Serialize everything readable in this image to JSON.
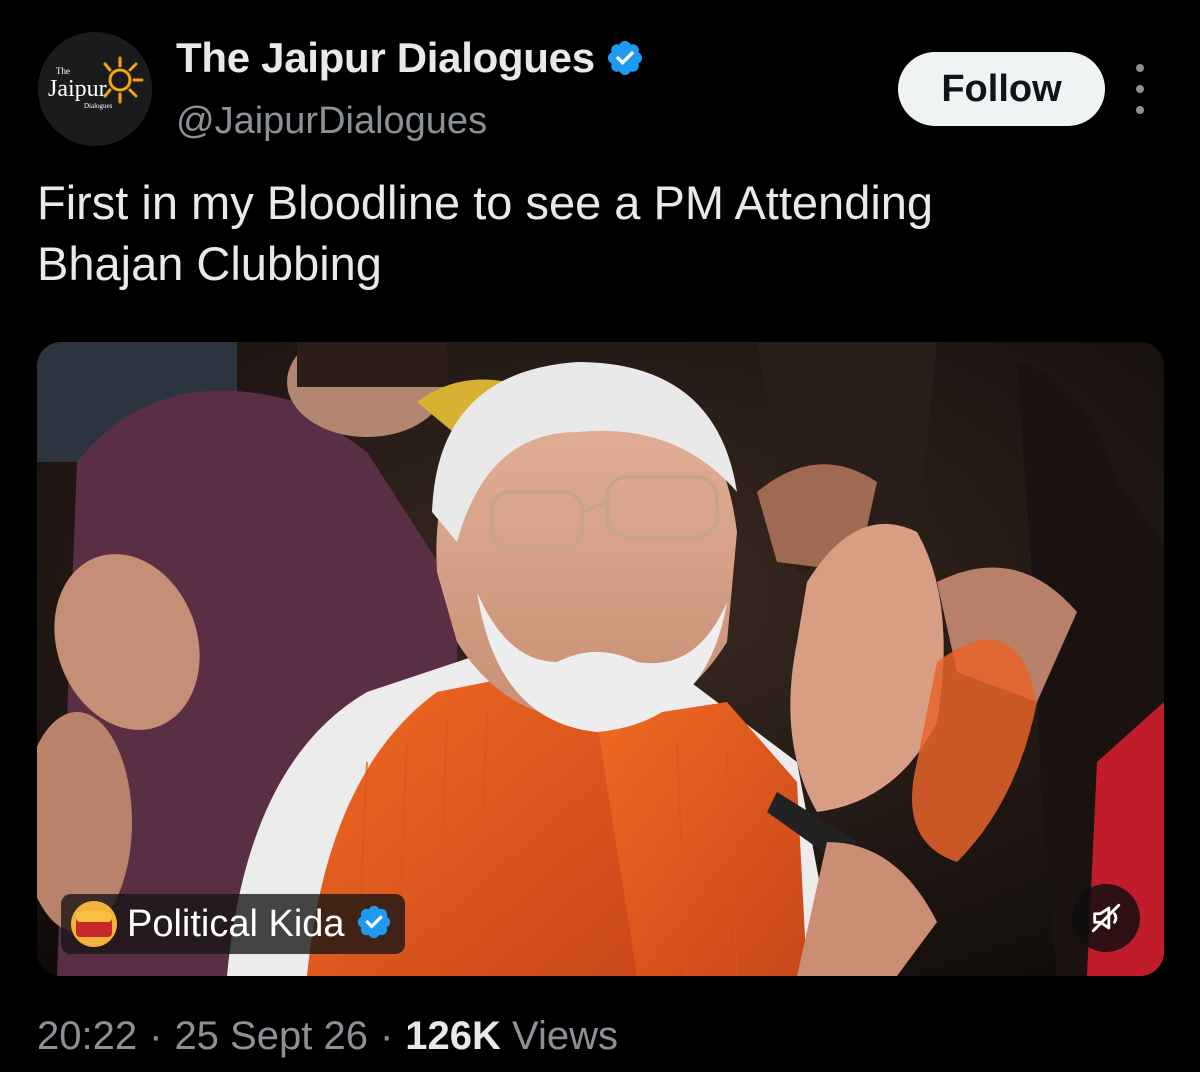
{
  "author": {
    "display_name": "The Jaipur Dialogues",
    "handle": "@JaipurDialogues",
    "verified": true,
    "avatar": {
      "top_text": "The",
      "main_text": "Jaipur",
      "sub_text": "Dialogues",
      "accent_color": "#f2a516"
    }
  },
  "actions": {
    "follow_label": "Follow",
    "more_icon": "more-vertical-icon"
  },
  "tweet": {
    "text": "First in my Bloodline to see a PM Attending\nBhajan Clubbing"
  },
  "media": {
    "type": "video",
    "source_name": "Political Kida",
    "source_verified": true,
    "source_logo_text": "Political Kida",
    "mute_icon": "volume-muted-icon"
  },
  "meta": {
    "time": "20:22",
    "separator": "·",
    "date": "25 Sept 26",
    "views_count": "126K",
    "views_label": "Views"
  },
  "colors": {
    "background": "#000000",
    "text_primary": "#e7e9ea",
    "text_secondary": "#8b9196",
    "verified_blue": "#1d9bf0",
    "follow_bg": "#eff3f4"
  }
}
